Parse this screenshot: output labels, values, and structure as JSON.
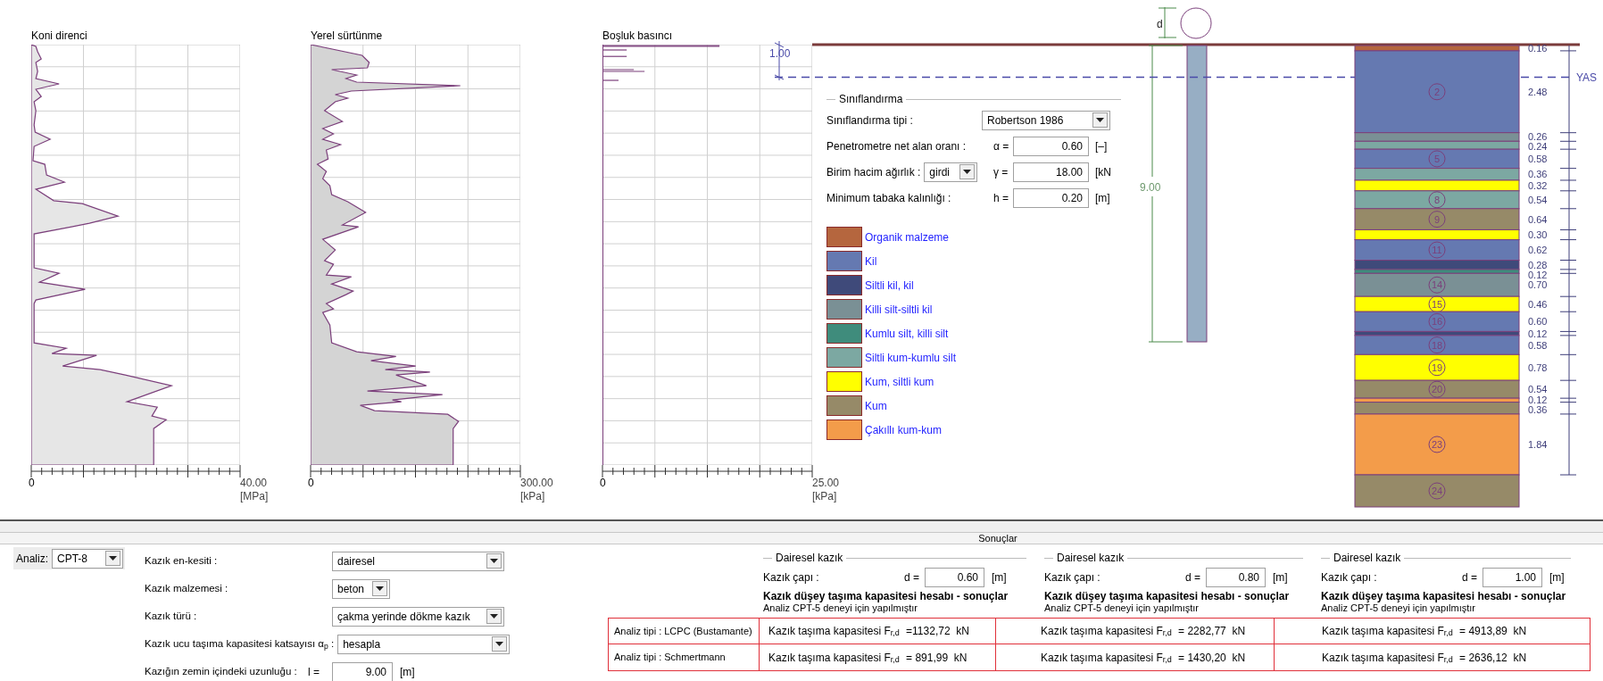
{
  "charts": [
    {
      "kind": "cone",
      "title": "Koni direnci",
      "axis_min": "0",
      "axis_max": "40.00",
      "unit": "[MPa]"
    },
    {
      "kind": "friction",
      "title": "Yerel sürtünme",
      "axis_min": "0",
      "axis_max": "300.00",
      "unit": "[kPa]"
    },
    {
      "kind": "pore",
      "title": "Boşluk basıncı",
      "axis_min": "0",
      "axis_max": "25.00",
      "unit": "[kPa]"
    }
  ],
  "profile": {
    "water_depth_label": "1.00",
    "water_level_label": "YAS",
    "pile_diameter_label": "d",
    "pile_length_label": "9.00",
    "layers": [
      {
        "color": "#b5663e",
        "thickness": "0.16"
      },
      {
        "color": "#6579b1",
        "thickness": "2.48",
        "number": "2"
      },
      {
        "color": "#7a9095",
        "thickness": "0.26"
      },
      {
        "color": "#7ca8a2",
        "thickness": "0.24"
      },
      {
        "color": "#6579b1",
        "thickness": "0.58",
        "number": "5"
      },
      {
        "color": "#7ca8a2",
        "thickness": "0.36"
      },
      {
        "color": "#ffff00",
        "thickness": "0.32"
      },
      {
        "color": "#7ca8a2",
        "thickness": "0.54",
        "number": "8"
      },
      {
        "color": "#968a68",
        "thickness": "0.64",
        "number": "9"
      },
      {
        "color": "#ffff00",
        "thickness": "0.30"
      },
      {
        "color": "#6579b1",
        "thickness": "0.62",
        "number": "11"
      },
      {
        "color": "#3f4a7a",
        "thickness": "0.28"
      },
      {
        "color": "#3f8c7c",
        "thickness": "0.12"
      },
      {
        "color": "#7a9095",
        "thickness": "0.70",
        "number": "14"
      },
      {
        "color": "#ffff00",
        "thickness": "0.46",
        "number": "15"
      },
      {
        "color": "#6579b1",
        "thickness": "0.60",
        "number": "16"
      },
      {
        "color": "#3f4a7a",
        "thickness": "0.12"
      },
      {
        "color": "#6579b1",
        "thickness": "0.58",
        "number": "18"
      },
      {
        "color": "#ffff00",
        "thickness": "0.78",
        "number": "19"
      },
      {
        "color": "#968a68",
        "thickness": "0.54",
        "number": "20"
      },
      {
        "color": "#f39c4a",
        "thickness": "0.12"
      },
      {
        "color": "#968a68",
        "thickness": "0.36"
      },
      {
        "color": "#f39c4a",
        "thickness": "1.84",
        "number": "23"
      },
      {
        "color": "#968a68",
        "number": "24"
      }
    ]
  },
  "classification": {
    "title": "Sınıflandırma",
    "fields": [
      {
        "kind": "select",
        "label": "Sınıflandırma tipi :",
        "value": "Robertson 1986"
      },
      {
        "kind": "input",
        "label": "Penetrometre net alan oranı :",
        "symbol": "α =",
        "value": "0.60",
        "unit": "[–]"
      },
      {
        "kind": "select_input",
        "label": "Birim hacim ağırlık :",
        "option": "girdi",
        "symbol": "γ =",
        "value": "18.00",
        "unit": "[kN"
      },
      {
        "kind": "input",
        "label": "Minimum tabaka kalınlığı :",
        "symbol": "h =",
        "value": "0.20",
        "unit": "[m]"
      }
    ],
    "legend": [
      {
        "label": "Organik malzeme",
        "color": "#b5663e"
      },
      {
        "label": "Kil",
        "color": "#6579b1"
      },
      {
        "label": "Siltli kil, kil",
        "color": "#3f4a7a"
      },
      {
        "label": "Killi silt-siltli kil",
        "color": "#7a9095"
      },
      {
        "label": "Kumlu silt, killi silt",
        "color": "#3f8c7c"
      },
      {
        "label": "Siltli kum-kumlu silt",
        "color": "#7ca8a2"
      },
      {
        "label": "Kum, siltli kum",
        "color": "#ffff00"
      },
      {
        "label": "Kum",
        "color": "#968a68"
      },
      {
        "label": "Çakıllı kum-kum",
        "color": "#f39c4a"
      }
    ]
  },
  "results_header": "Sonuçlar",
  "analysis": {
    "label": "Analiz:",
    "value": "CPT-8"
  },
  "pile_form": [
    {
      "kind": "select",
      "label": "Kazık en-kesiti :",
      "value": "dairesel"
    },
    {
      "kind": "short_select",
      "label": "Kazık malzemesi :",
      "value": "beton"
    },
    {
      "kind": "select",
      "label": "Kazık türü :",
      "value": "çakma yerinde dökme kazık"
    },
    {
      "kind": "select",
      "label": "Kazık ucu taşıma kapasitesi katsayısı α$_{p}$ :",
      "value": "hesapla"
    },
    {
      "kind": "input",
      "label": "Kazığın zemin içindeki uzunluğu :",
      "symbol": "l =",
      "value": "9.00",
      "unit": "[m]"
    }
  ],
  "diameters": [
    {
      "title": "Dairesel kazık",
      "label": "Kazık çapı :",
      "symbol": "d =",
      "value": "0.60",
      "unit": "[m]",
      "heading": "Kazık düşey taşıma kapasitesi hesabı - sonuçlar",
      "note": "Analiz CPT-5 deneyi için yapılmıştır"
    },
    {
      "title": "Dairesel kazık",
      "label": "Kazık çapı :",
      "symbol": "d =",
      "value": "0.80",
      "unit": "[m]",
      "heading": "Kazık düşey taşıma kapasitesi hesabı - sonuçlar",
      "note": "Analiz CPT-5 deneyi için yapılmıştır"
    },
    {
      "title": "Dairesel kazık",
      "label": "Kazık çapı :",
      "symbol": "d =",
      "value": "1.00",
      "unit": "[m]",
      "heading": "Kazık düşey taşıma kapasitesi hesabı - sonuçlar",
      "note": "Analiz CPT-5 deneyi için yapılmıştır"
    }
  ],
  "results_table": {
    "rows": [
      {
        "label": "Analiz tipi : LCPC (Bustamante)",
        "cells": [
          "Kazık taşıma kapasitesi F$_{r,d}$ =1132,72  kN",
          "Kazık taşıma kapasitesi F$_{r,d}$ = 2282,77  kN",
          "Kazık taşıma kapasitesi F$_{r,d}$ = 4913,89  kN"
        ]
      },
      {
        "label": "Analiz tipi : Schmertmann",
        "cells": [
          "Kazık taşıma kapasitesi F$_{r,d}$ = 891,99  kN",
          "Kazık taşıma kapasitesi F$_{r,d}$ = 1430,20  kN",
          "Kazık taşıma kapasitesi F$_{r,d}$ = 2636,12  kN"
        ]
      }
    ]
  }
}
